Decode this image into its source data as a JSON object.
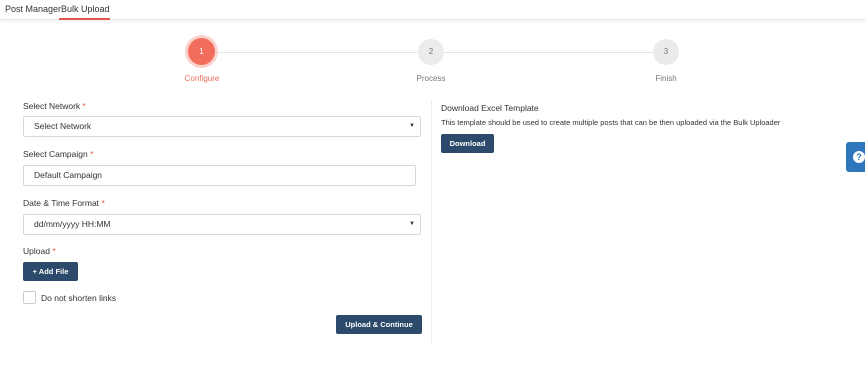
{
  "tabs": [
    {
      "label": "Post Manager"
    },
    {
      "label": "Bulk Upload"
    }
  ],
  "stepper": {
    "steps": [
      {
        "number": "1",
        "label": "Configure"
      },
      {
        "number": "2",
        "label": "Process"
      },
      {
        "number": "3",
        "label": "Finish"
      }
    ]
  },
  "form": {
    "network": {
      "label": "Select Network",
      "required_mark": "*",
      "value": "Select Network"
    },
    "campaign": {
      "label": "Select Campaign",
      "required_mark": "*",
      "value": "Default Campaign"
    },
    "datetime": {
      "label": "Date & Time Format",
      "required_mark": "*",
      "value": "dd/mm/yyyy HH:MM"
    },
    "upload": {
      "label": "Upload",
      "required_mark": "*",
      "button_label": "+ Add File"
    },
    "shorten": {
      "label": "Do not shorten links"
    },
    "submit_label": "Upload & Continue"
  },
  "template_panel": {
    "title": "Download Excel Template",
    "description": "This template should be used to create multiple posts that can be then uploaded via the Bulk Uploader",
    "button_label": "Download"
  },
  "help": {
    "icon": "question-icon",
    "glyph": "?"
  },
  "colors": {
    "accent": "#f26d5b",
    "primary_button": "#2c4a6b",
    "help_tab": "#2e77bd",
    "required": "#e8554e"
  }
}
